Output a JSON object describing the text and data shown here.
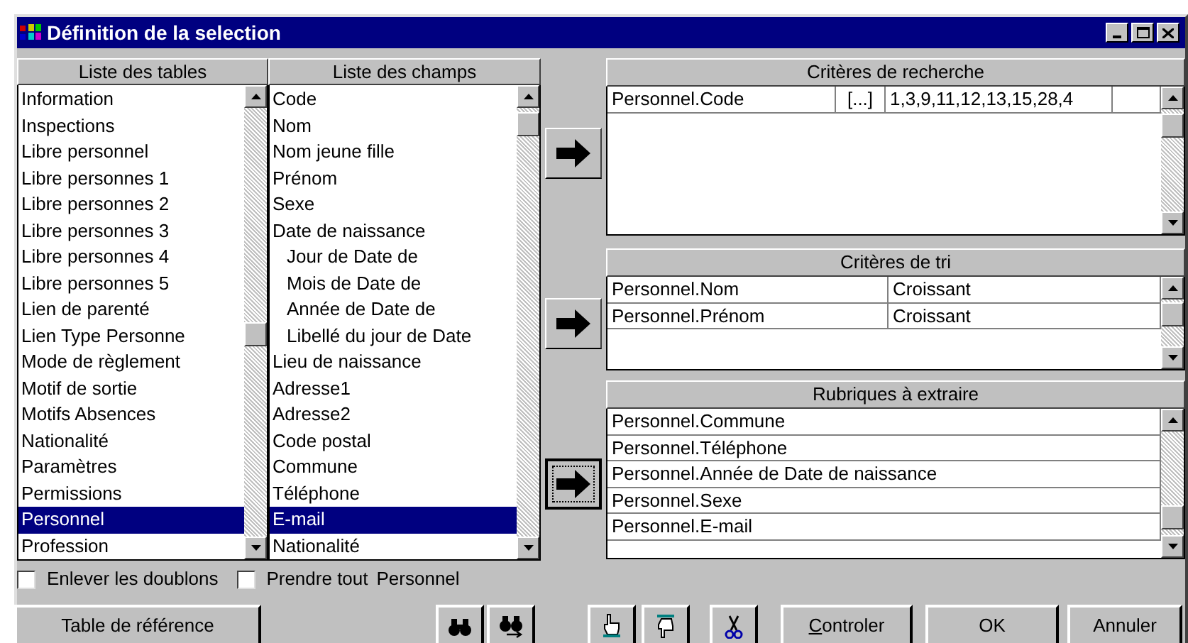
{
  "window": {
    "title": "Définition de la selection"
  },
  "tables_list": {
    "header": "Liste des tables",
    "items": [
      {
        "label": "Information",
        "selected": false
      },
      {
        "label": "Inspections",
        "selected": false
      },
      {
        "label": "Libre personnel",
        "selected": false
      },
      {
        "label": "Libre personnes 1",
        "selected": false
      },
      {
        "label": "Libre personnes 2",
        "selected": false
      },
      {
        "label": "Libre personnes 3",
        "selected": false
      },
      {
        "label": "Libre personnes 4",
        "selected": false
      },
      {
        "label": "Libre personnes 5",
        "selected": false
      },
      {
        "label": "Lien de parenté",
        "selected": false
      },
      {
        "label": "Lien Type Personne",
        "selected": false
      },
      {
        "label": "Mode de règlement",
        "selected": false
      },
      {
        "label": "Motif de sortie",
        "selected": false
      },
      {
        "label": "Motifs Absences",
        "selected": false
      },
      {
        "label": "Nationalité",
        "selected": false
      },
      {
        "label": "Paramètres",
        "selected": false
      },
      {
        "label": "Permissions",
        "selected": false
      },
      {
        "label": "Personnel",
        "selected": true
      },
      {
        "label": "Profession",
        "selected": false
      }
    ]
  },
  "fields_list": {
    "header": "Liste des champs",
    "items": [
      {
        "label": "Code",
        "selected": false
      },
      {
        "label": "Nom",
        "selected": false
      },
      {
        "label": "Nom jeune fille",
        "selected": false
      },
      {
        "label": "Prénom",
        "selected": false
      },
      {
        "label": "Sexe",
        "selected": false
      },
      {
        "label": "Date de naissance",
        "selected": false,
        "children": [
          {
            "label": "Jour de Date de",
            "selected": false
          },
          {
            "label": "Mois de Date de",
            "selected": false
          },
          {
            "label": "Année de Date de",
            "selected": false
          },
          {
            "label": "Libellé du jour de Date",
            "selected": false
          }
        ]
      },
      {
        "label": "Lieu de naissance",
        "selected": false
      },
      {
        "label": "Adresse1",
        "selected": false
      },
      {
        "label": "Adresse2",
        "selected": false
      },
      {
        "label": "Code postal",
        "selected": false
      },
      {
        "label": "Commune",
        "selected": false
      },
      {
        "label": "Téléphone",
        "selected": false
      },
      {
        "label": "E-mail",
        "selected": true
      },
      {
        "label": "Nationalité",
        "selected": false
      }
    ]
  },
  "transfer_buttons": [
    {
      "focused": false
    },
    {
      "focused": false
    },
    {
      "focused": true
    }
  ],
  "search_criteria": {
    "header": "Critères de recherche",
    "rows": [
      {
        "field": "Personnel.Code",
        "button": "[...]",
        "value": "1,3,9,11,12,13,15,28,4"
      }
    ]
  },
  "sort_criteria": {
    "header": "Critères de tri",
    "rows": [
      {
        "field": "Personnel.Nom",
        "order": "Croissant"
      },
      {
        "field": "Personnel.Prénom",
        "order": "Croissant"
      }
    ]
  },
  "extract_fields": {
    "header": "Rubriques à extraire",
    "rows": [
      "Personnel.Commune",
      "Personnel.Téléphone",
      "Personnel.Année de Date de naissance",
      "Personnel.Sexe",
      "Personnel.E-mail"
    ]
  },
  "options": [
    {
      "label": "Enlever les doublons",
      "checked": false
    },
    {
      "label": "Prendre tout",
      "table": "Personnel",
      "checked": false
    }
  ],
  "buttons": [
    {
      "kind": "text",
      "label": "Table de référence"
    },
    {
      "kind": "binoculars"
    },
    {
      "kind": "binoculars-arrow"
    },
    {
      "kind": "hand-up"
    },
    {
      "kind": "hand-down"
    },
    {
      "kind": "scissors"
    },
    {
      "kind": "text",
      "label": "Controler",
      "underline_first": true
    },
    {
      "kind": "text",
      "label": "OK"
    },
    {
      "kind": "text",
      "label": "Annuler"
    }
  ]
}
